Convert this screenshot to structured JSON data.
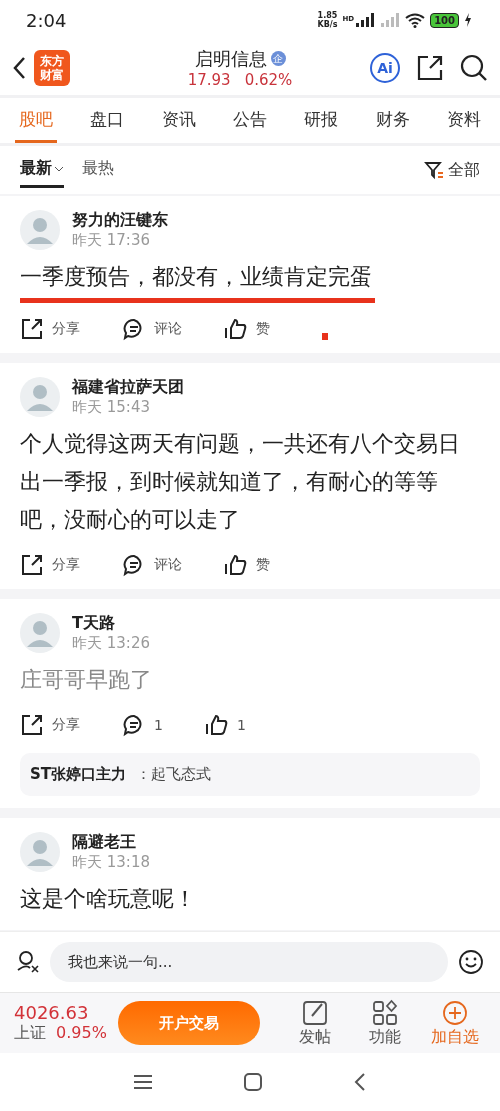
{
  "status_bar": {
    "time": "2:04",
    "speed": "1.85\nKB/s",
    "network": "HD",
    "battery": "100"
  },
  "header": {
    "logo": [
      "东方",
      "财富"
    ],
    "title": "启明信息",
    "badge": "企",
    "price": "17.93",
    "change": "0.62%",
    "ai": "Ai"
  },
  "tabs": [
    {
      "label": "股吧",
      "selected": true
    },
    {
      "label": "盘口",
      "selected": false
    },
    {
      "label": "资讯",
      "selected": false
    },
    {
      "label": "公告",
      "selected": false
    },
    {
      "label": "研报",
      "selected": false
    },
    {
      "label": "财务",
      "selected": false
    },
    {
      "label": "资料",
      "selected": false
    }
  ],
  "sort_tabs": [
    {
      "label": "最新",
      "selected": true
    },
    {
      "label": "最热",
      "selected": false
    }
  ],
  "filter": "全部",
  "posts": [
    {
      "user": "努力的汪键东",
      "time": "昨天 17:36",
      "text": "一季度预告，都没有，业绩肯定完蛋",
      "dimmed": false,
      "underlined": true,
      "share": "分享",
      "comment": "评论",
      "like": "赞"
    },
    {
      "user": "福建省拉萨天团",
      "time": "昨天 15:43",
      "text": "个人觉得这两天有问题，一共还有八个交易日出一季报，到时候就知道了，有耐心的等等吧，没耐心的可以走了",
      "dimmed": false,
      "underlined": false,
      "share": "分享",
      "comment": "评论",
      "like": "赞"
    },
    {
      "user": "T天路",
      "time": "昨天 13:26",
      "text": "庄哥哥早跑了",
      "dimmed": true,
      "underlined": false,
      "share": "分享",
      "comment": "1",
      "like": "1",
      "reply": {
        "user": "ST张婷口主力",
        "text": "：起飞态式"
      }
    },
    {
      "user": "隔避老王",
      "time": "昨天 13:18",
      "text": "这是个啥玩意呢！",
      "dimmed": false,
      "underlined": false
    }
  ],
  "input": {
    "placeholder": "我也来说一句..."
  },
  "bottom": {
    "index_value": "4026.63",
    "index_name": "上证",
    "index_change": "0.95%",
    "trade": "开户交易",
    "actions": [
      {
        "label": "发帖",
        "kind": "post",
        "selected": false
      },
      {
        "label": "功能",
        "kind": "grid",
        "selected": false
      },
      {
        "label": "加自选",
        "kind": "add",
        "selected": true
      }
    ]
  }
}
